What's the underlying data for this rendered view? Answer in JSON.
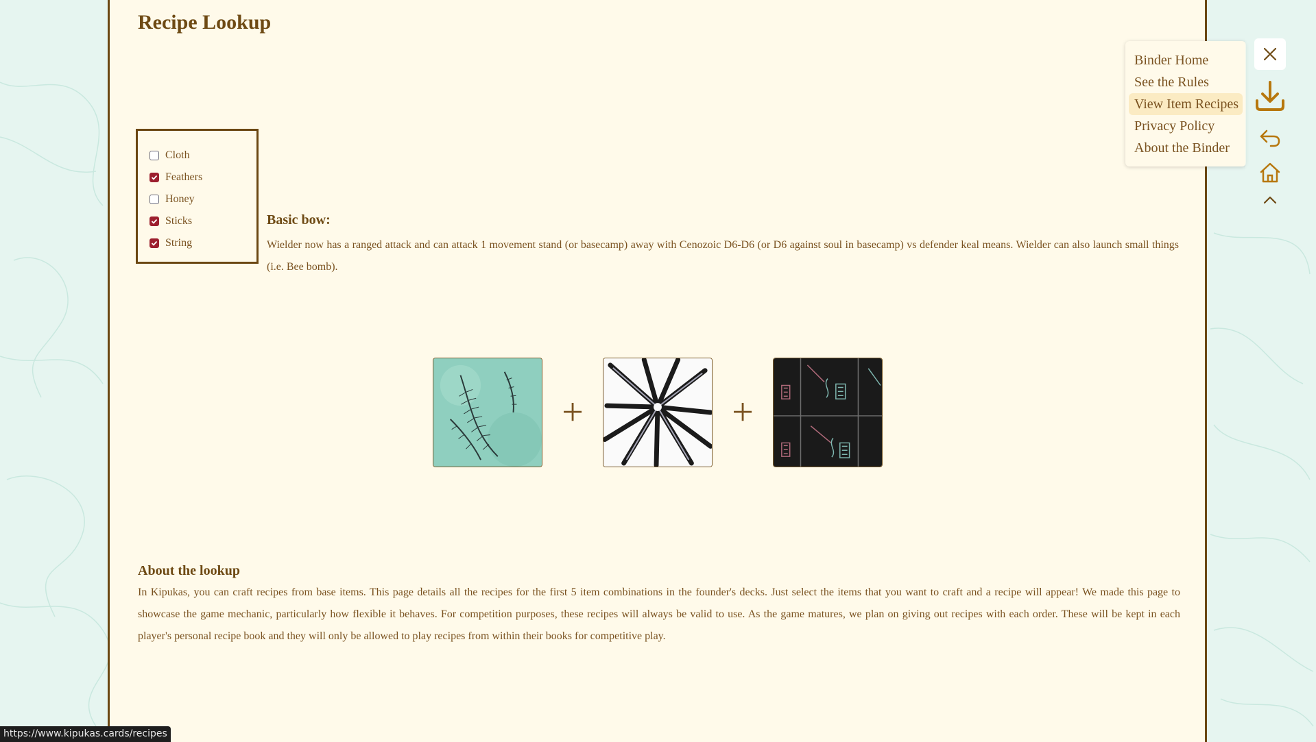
{
  "page": {
    "title": "Recipe Lookup"
  },
  "filters": [
    {
      "label": "Cloth",
      "checked": false
    },
    {
      "label": "Feathers",
      "checked": true
    },
    {
      "label": "Honey",
      "checked": false
    },
    {
      "label": "Sticks",
      "checked": true
    },
    {
      "label": "String",
      "checked": true
    }
  ],
  "recipe": {
    "title": "Basic bow:",
    "description": "Wielder now has a ranged attack and can attack 1 movement stand (or basecamp) away with Cenozoic D6-D6 (or D6 against soul in basecamp) vs defender keal means. Wielder can also launch small things (i.e. Bee bomb).",
    "ingredients": [
      "feathers-card-image",
      "sticks-card-image",
      "string-card-image"
    ],
    "plus_symbol": "+"
  },
  "about": {
    "title": "About the lookup",
    "text": "In Kipukas, you can craft recipes from base items. This page details all the recipes for the first 5 item combinations in the founder's decks. Just select the items that you want to craft and a recipe will appear! We made this page to showcase the game mechanic, particularly how flexible it behaves. For competition purposes, these recipes will always be valid to use. As the game matures, we plan on giving out recipes with each order. These will be kept in each player's personal recipe book and they will only be allowed to play recipes from within their books for competitive play."
  },
  "menu": {
    "items": [
      {
        "label": "Binder Home",
        "active": false
      },
      {
        "label": "See the Rules",
        "active": false
      },
      {
        "label": "View Item Recipes",
        "active": true
      },
      {
        "label": "Privacy Policy",
        "active": false
      },
      {
        "label": "About the Binder",
        "active": false
      }
    ]
  },
  "toolbar": {
    "icons": [
      "close-icon",
      "download-icon",
      "back-arrow-icon",
      "home-icon",
      "chevron-up-icon"
    ]
  },
  "status_bar": {
    "url": "https://www.kipukas.cards/recipes"
  },
  "colors": {
    "accent": "#6b4712",
    "text": "#7a5220",
    "page_bg": "#fffaea",
    "outer_bg": "#e6f5f0",
    "checkbox_checked": "#9c1f2e",
    "menu_active": "#fbebc3"
  }
}
